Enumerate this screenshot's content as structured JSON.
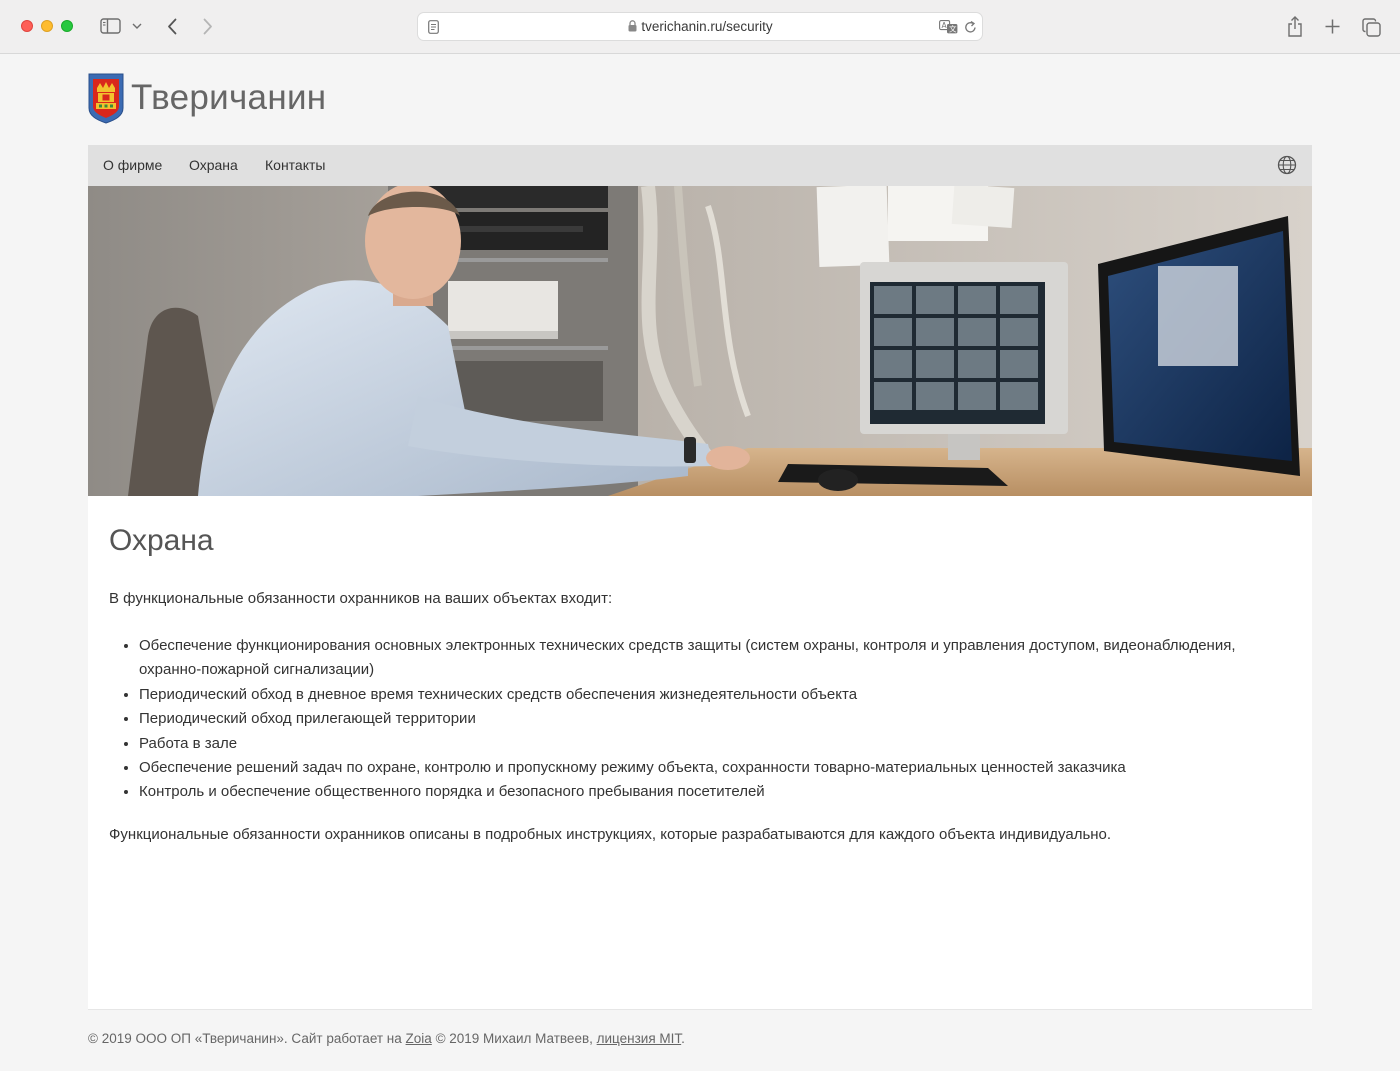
{
  "browser": {
    "url": "tverichanin.ru/security"
  },
  "site": {
    "title": "Тверичанин"
  },
  "nav": {
    "items": [
      "О фирме",
      "Охрана",
      "Контакты"
    ]
  },
  "main": {
    "heading": "Охрана",
    "intro": "В функциональные обязанности охранников на ваших объектах входит:",
    "duties": [
      "Обеспечение функционирования основных электронных технических средств защиты (систем охраны, контроля и управления доступом, видеонаблюдения, охранно-пожарной сигнализации)",
      "Периодический обход в дневное время технических средств обеспечения жизнедеятельности объекта",
      "Периодический обход прилегающей территории",
      "Работа в зале",
      "Обеспечение решений задач по охране, контролю и пропускному режиму объекта, сохранности товарно-материальных ценностей заказчика",
      "Контроль и обеспечение общественного порядка и безопасного пребывания посетителей"
    ],
    "outro": "Функциональные обязанности охранников описаны в подробных инструкциях, которые разрабатываются для каждого объекта индивидуально."
  },
  "footer": {
    "prefix": "© 2019 ООО ОП «Тверичанин». Сайт работает на",
    "zoia_link": "Zoia",
    "middle": "© 2019 Михаил Матвеев,",
    "license_link": "лицензия MIT",
    "suffix": "."
  },
  "icons": {
    "sidebar": "sidebar-icon",
    "back": "chevron-left-icon",
    "forward": "chevron-right-icon",
    "page": "page-icon",
    "lock": "lock-icon",
    "translate": "translate-icon",
    "reload": "reload-icon",
    "share": "share-icon",
    "new_tab": "plus-icon",
    "tabs": "tabs-icon",
    "language": "globe-icon"
  },
  "colors": {
    "navbar_bg": "#e0e0e0",
    "page_bg": "#f5f5f5",
    "content_bg": "#ffffff"
  }
}
